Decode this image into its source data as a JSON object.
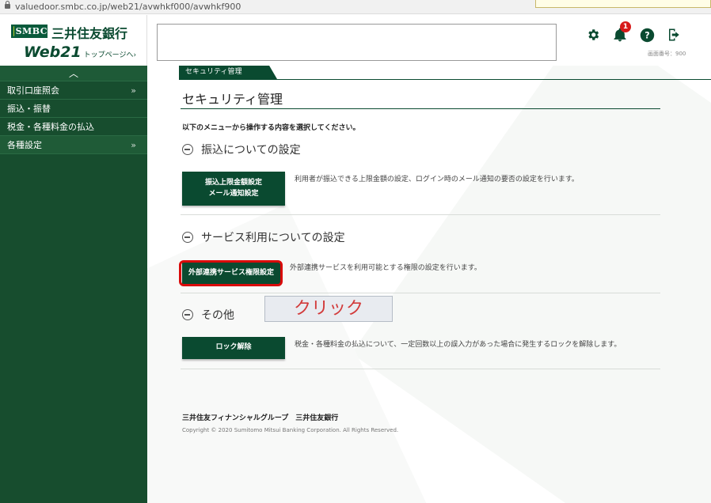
{
  "browser": {
    "url": "valuedoor.smbc.co.jp/web21/avwhkf000/avwhkf900"
  },
  "header": {
    "logo_mark": "SMBC",
    "bank_name": "三井住友銀行",
    "product": "Web21",
    "product_sub": "トップページへ›",
    "notification_count": "1",
    "screen_number": "画面番号：900",
    "icons": [
      "gear-icon",
      "bell-icon",
      "help-icon",
      "logout-icon"
    ]
  },
  "sidebar": {
    "collapse_label": "︿",
    "items": [
      {
        "label": "取引口座照会",
        "arrow": "»"
      },
      {
        "label": "振込・振替",
        "arrow": ""
      },
      {
        "label": "税金・各種料金の払込",
        "arrow": ""
      },
      {
        "label": "各種設定",
        "arrow": "»"
      }
    ]
  },
  "main": {
    "breadcrumb": "セキュリティ管理",
    "title": "セキュリティ管理",
    "intro": "以下のメニューから操作する内容を選択してください。",
    "sections": [
      {
        "heading": "振込についての設定",
        "button": "振込上限金額設定\nメール通知設定",
        "description": "利用者が振込できる上限金額の設定、ログイン時のメール通知の要否の設定を行います。"
      },
      {
        "heading": "サービス利用についての設定",
        "button": "外部連携サービス権限設定",
        "description": "外部連携サービスを利用可能とする権限の設定を行います。"
      },
      {
        "heading": "その他",
        "button": "ロック解除",
        "description": "税金・各種料金の払込について、一定回数以上の誤入力があった場合に発生するロックを解除します。"
      }
    ],
    "annotation": "クリック"
  },
  "footer": {
    "company": "三井住友フィナンシャルグループ　三井住友銀行",
    "copyright": "Copyright © 2020 Sumitomo Mitsui Banking Corporation. All Rights Reserved."
  },
  "colors": {
    "brand_green": "#0a4a30",
    "sidebar_bg": "#174d2e",
    "highlight_red": "#d90b0b",
    "badge_red": "#d71a1a"
  }
}
